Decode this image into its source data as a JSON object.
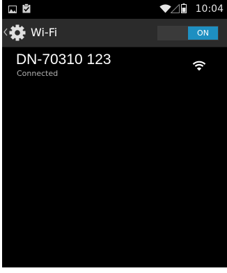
{
  "status_bar": {
    "time": "10:04",
    "icons": [
      "image-notification-icon",
      "clipboard-check-notification-icon",
      "wifi-signal-icon",
      "cell-signal-icon",
      "battery-icon"
    ]
  },
  "action_bar": {
    "title": "Wi-Fi",
    "toggle_label": "ON",
    "icons": [
      "up-chevron-icon",
      "settings-gear-icon"
    ]
  },
  "networks": [
    {
      "ssid": "DN-70310 123",
      "status": "Connected",
      "icon": "wifi-signal-icon"
    }
  ],
  "colors": {
    "background": "#000000",
    "action_bar": "#2b2b2b",
    "toggle_on": "#1e8fc1",
    "toggle_off": "#3a3a3a"
  }
}
